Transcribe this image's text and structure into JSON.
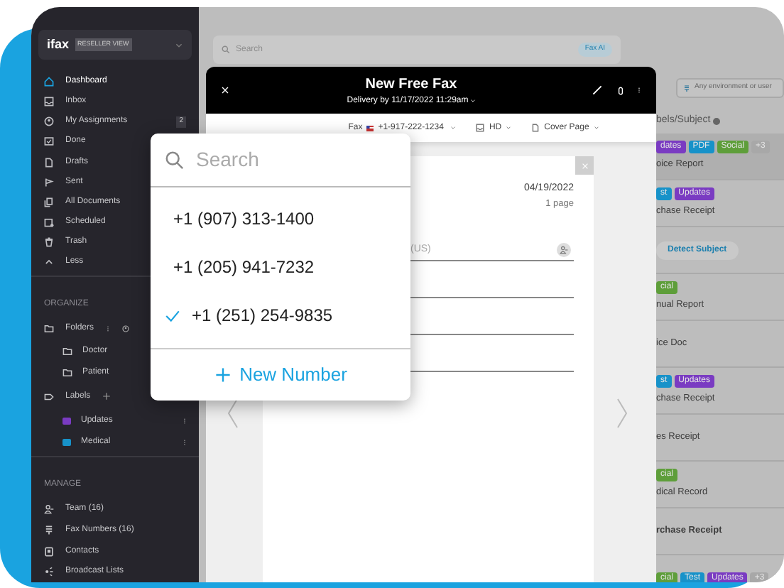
{
  "sidebar": {
    "logo": "ifax",
    "badge": "RESELLER VIEW",
    "nav": [
      {
        "label": "Dashboard",
        "selected": true
      },
      {
        "label": "Inbox",
        "selected": false
      },
      {
        "label": "My Assignments",
        "selected": false,
        "count": "2"
      },
      {
        "label": "Done",
        "selected": false
      },
      {
        "label": "Drafts",
        "selected": false
      },
      {
        "label": "Sent",
        "selected": false
      },
      {
        "label": "All Documents",
        "selected": false
      },
      {
        "label": "Scheduled",
        "selected": false
      },
      {
        "label": "Trash",
        "selected": false
      },
      {
        "label": "Less",
        "selected": false
      }
    ],
    "organize": {
      "heading": "ORGANIZE",
      "folders": {
        "label": "Folders",
        "children": [
          {
            "label": "Doctor"
          },
          {
            "label": "Patient"
          }
        ]
      },
      "labels": {
        "label": "Labels",
        "children": [
          {
            "label": "Updates",
            "color": "#7a3bc2"
          },
          {
            "label": "Medical",
            "color": "#1792c9"
          }
        ]
      }
    },
    "manage": {
      "heading": "MANAGE",
      "items": [
        {
          "label": "Team (16)"
        },
        {
          "label": "Fax Numbers (16)"
        },
        {
          "label": "Contacts"
        },
        {
          "label": "Broadcast Lists"
        }
      ]
    }
  },
  "search": {
    "placeholder": "Search",
    "ai_button": "Fax AI"
  },
  "filter": {
    "value": "Any environment or user"
  },
  "list": {
    "column": "bels/Subject",
    "rows": [
      {
        "selected": true,
        "bold": false,
        "subject": "oice Report",
        "tags": [
          {
            "label": "dates",
            "color": "#7a3bc2"
          },
          {
            "label": "PDF",
            "color": "#1792c9"
          },
          {
            "label": "Social",
            "color": "#5e9e3a"
          },
          {
            "label": "+3",
            "color": "#a8a8a8"
          }
        ]
      },
      {
        "selected": false,
        "bold": false,
        "subject": "chase Receipt",
        "tags": [
          {
            "label": "st",
            "color": "#1792c9"
          },
          {
            "label": "Updates",
            "color": "#7a3bc2"
          }
        ]
      },
      {
        "selected": false,
        "detect": "Detect Subject"
      },
      {
        "selected": false,
        "bold": false,
        "subject": "nual Report",
        "tags": [
          {
            "label": "cial",
            "color": "#5e9e3a"
          }
        ]
      },
      {
        "selected": false,
        "bold": false,
        "subject": "ice Doc"
      },
      {
        "selected": false,
        "bold": false,
        "subject": "chase Receipt",
        "tags": [
          {
            "label": "st",
            "color": "#1792c9"
          },
          {
            "label": "Updates",
            "color": "#7a3bc2"
          }
        ]
      },
      {
        "selected": false,
        "bold": false,
        "subject": "es Receipt"
      },
      {
        "selected": false,
        "bold": false,
        "subject": "dical Record",
        "tags": [
          {
            "label": "cial",
            "color": "#5e9e3a"
          }
        ]
      },
      {
        "selected": false,
        "bold": true,
        "subject": "rchase Receipt"
      },
      {
        "selected": false,
        "tags": [
          {
            "label": "cial",
            "color": "#5e9e3a"
          },
          {
            "label": "Test",
            "color": "#1792c9"
          },
          {
            "label": "Updates",
            "color": "#7a3bc2"
          },
          {
            "label": "+3",
            "color": "#a8a8a8"
          }
        ]
      }
    ]
  },
  "compose": {
    "title": "New Free Fax",
    "delivery": "Delivery by 11/17/2022 11:29am",
    "from_label": "Fax",
    "from": "+1-917-222-1234",
    "quality": "HD",
    "cover": "Cover Page",
    "date": "04/19/2022",
    "pages": "1 page",
    "recipient_placeholder": "(US)"
  },
  "number_menu": {
    "placeholder": "Search",
    "numbers": [
      {
        "number": "+1 (907) 313-1400",
        "selected": false
      },
      {
        "number": "+1 (205) 941-7232",
        "selected": false
      },
      {
        "number": "+1 (251) 254-9835",
        "selected": true
      }
    ],
    "add": "New Number"
  }
}
